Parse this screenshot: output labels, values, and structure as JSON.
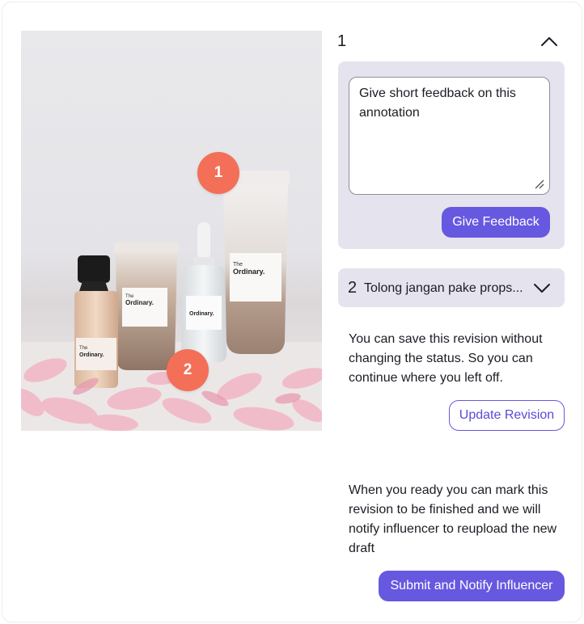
{
  "photo": {
    "alt": "The Ordinary skincare products arranged on pink petals",
    "brand_text": "The Ordinary.",
    "pins": [
      "1",
      "2"
    ]
  },
  "annotation_1": {
    "number": "1",
    "feedback_placeholder": "Give short feedback on this annotation",
    "give_feedback_label": "Give Feedback",
    "expanded": true
  },
  "annotation_2": {
    "number": "2",
    "text": "Tolong jangan pake props...",
    "expanded": false
  },
  "save_info": "You can save this revision without changing the status. So you can continue where you left off.",
  "update_revision_label": "Update Revision",
  "submit_info": "When you ready you can mark this revision to be finished and we will notify influencer to reupload the new draft",
  "submit_label": "Submit and Notify Influencer",
  "colors": {
    "accent": "#6758e0",
    "pin": "#f36f58",
    "panel": "#e5e4ee"
  },
  "icons": [
    "chevron-up-icon",
    "chevron-down-icon",
    "resize-grip-icon"
  ]
}
